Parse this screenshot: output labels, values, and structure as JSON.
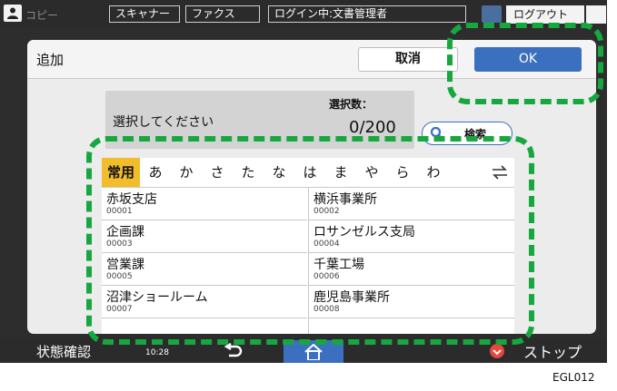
{
  "header": {
    "copy_label": "コピー",
    "tabs": [
      {
        "label": "スキャナー"
      },
      {
        "label": "ファクス"
      },
      {
        "label": "ログイン中:文書管理者"
      }
    ],
    "logout_label": "ログアウト"
  },
  "dialog": {
    "title": "追加",
    "cancel_label": "取消",
    "ok_label": "OK",
    "prompt": "選択してください",
    "count_label": "選択数：",
    "count_value": "0/200",
    "search_label": "検索"
  },
  "index_tabs": [
    "常用",
    "あ",
    "か",
    "さ",
    "た",
    "な",
    "は",
    "ま",
    "や",
    "ら",
    "わ"
  ],
  "entries": [
    {
      "name": "赤坂支店",
      "number": "00001"
    },
    {
      "name": "横浜事業所",
      "number": "00002"
    },
    {
      "name": "企画課",
      "number": "00003"
    },
    {
      "name": "ロサンゼルス支局",
      "number": "00004"
    },
    {
      "name": "営業課",
      "number": "00005"
    },
    {
      "name": "千葉工場",
      "number": "00006"
    },
    {
      "name": "沼津ショールーム",
      "number": "00007"
    },
    {
      "name": "鹿児島事業所",
      "number": "00008"
    }
  ],
  "footer": {
    "status_label": "状態確認",
    "time": "10:28",
    "stop_label": "ストップ"
  },
  "figure_code": "EGL012",
  "colors": {
    "accent_blue": "#3b6fc0",
    "active_tab": "#f2bc2a",
    "callout_green": "#16a83e",
    "stop_red": "#e8473c"
  }
}
